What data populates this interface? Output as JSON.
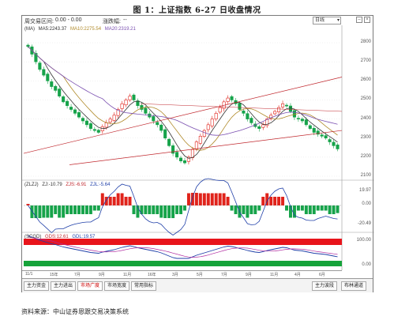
{
  "figure_title": "图 1：上证指数 6-27 日收盘情况",
  "source": "资料来源：中山证券恩跟交易决策系统",
  "toolbar": {
    "range_label": "周交易区间:",
    "range_value": "0.00 - 0.00",
    "change_label": "涨跌幅:",
    "change_value": "--",
    "period_select": "日线"
  },
  "main_panel": {
    "indicator_name": "(MA)",
    "ma5": "MA5:2243.37",
    "ma10": "MA10:2275.54",
    "ma20": "MA20:2319.21",
    "y_ticks": [
      "2800",
      "2700",
      "2600",
      "2500",
      "2400",
      "2300",
      "2200",
      "2100"
    ],
    "colors": {
      "up": "#e0231b",
      "down": "#16a34a",
      "ma5": "#333333",
      "ma10": "#b08a2a",
      "ma20": "#7a4fb0",
      "channel": "#c0272d"
    }
  },
  "zlzj_panel": {
    "label": "(ZLZJ)",
    "zj": "ZJ:-10.79",
    "zjs": "ZJS:-6.91",
    "zjl": "ZJL:-5.64",
    "y_ticks": [
      "19.97",
      "0.00",
      "-20.49"
    ]
  },
  "scgd_panel": {
    "label": "(SCGD)",
    "gds": "GDS:12.61",
    "gdl": "GDL:19.57",
    "y_ticks": [
      "100.00",
      "0.00"
    ]
  },
  "x_ticks": [
    "11/1",
    "15年",
    "7月",
    "9月",
    "11月",
    "16年",
    "3月",
    "5月",
    "7月",
    "9月",
    "11月",
    "4月",
    "6月"
  ],
  "bottom_tabs": [
    "主力资金",
    "主力进出",
    "市场广度",
    "市场宽度",
    "常用指标"
  ],
  "active_tab": "市场广度",
  "bottom_right": [
    "主力波段",
    "布林通道"
  ],
  "chart_data": {
    "type": "candlestick",
    "ylim": [
      2100,
      2850
    ],
    "series": [
      {
        "name": "price_close",
        "values": [
          2780,
          2740,
          2700,
          2660,
          2630,
          2600,
          2570,
          2550,
          2520,
          2490,
          2470,
          2450,
          2430,
          2410,
          2390,
          2370,
          2350,
          2340,
          2330,
          2360,
          2380,
          2400,
          2420,
          2450,
          2480,
          2500,
          2520,
          2500,
          2470,
          2450,
          2430,
          2410,
          2390,
          2370,
          2340,
          2300,
          2260,
          2220,
          2200,
          2180,
          2170,
          2200,
          2240,
          2280,
          2310,
          2340,
          2370,
          2400,
          2430,
          2460,
          2490,
          2510,
          2500,
          2480,
          2450,
          2430,
          2400,
          2380,
          2360,
          2350,
          2370,
          2400,
          2420,
          2440,
          2460,
          2480,
          2470,
          2440,
          2410,
          2400,
          2390,
          2370,
          2350,
          2330,
          2320,
          2310,
          2300,
          2280,
          2260,
          2243
        ]
      }
    ]
  }
}
